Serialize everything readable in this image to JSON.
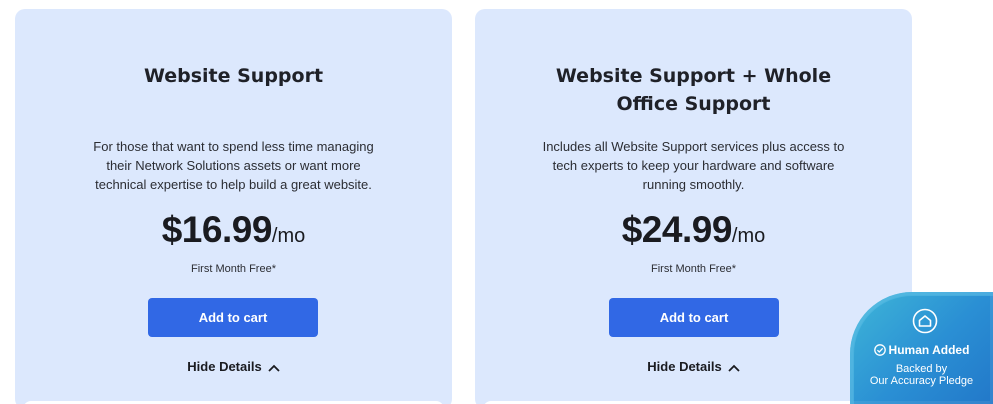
{
  "plans": [
    {
      "title": "Website Support",
      "description": "For those that want to spend less time managing their Network Solutions assets or want more technical expertise to help build a great website.",
      "price": "$16.99",
      "period": "/mo",
      "promo": "First Month Free*",
      "cta": "Add to cart",
      "details_toggle": "Hide Details"
    },
    {
      "title": "Website Support + Whole Office Support",
      "description": "Includes all Website Support services plus access to tech experts to keep your hardware and software running smoothly.",
      "price": "$24.99",
      "period": "/mo",
      "promo": "First Month Free*",
      "cta": "Add to cart",
      "details_toggle": "Hide Details"
    }
  ],
  "badge": {
    "title": "Human Added",
    "line1": "Backed by",
    "line2": "Our Accuracy Pledge",
    "icon": "house-shield-icon"
  },
  "colors": {
    "card_bg": "#dce8fd",
    "button": "#3168e5",
    "badge": "#2a8fd4"
  }
}
